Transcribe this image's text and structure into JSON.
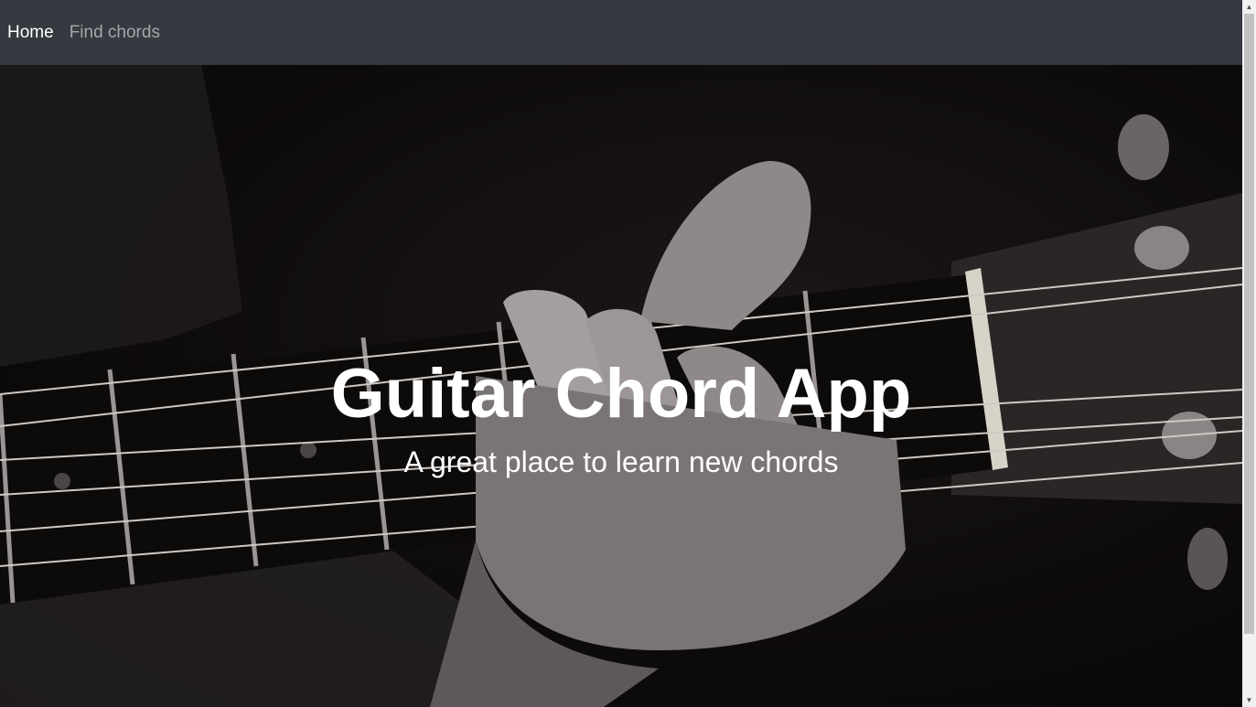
{
  "nav": {
    "home_label": "Home",
    "find_chords_label": "Find chords"
  },
  "hero": {
    "title": "Guitar Chord App",
    "subtitle": "A great place to learn new chords",
    "image_description_icon": "guitar-fretboard-hand-image"
  },
  "colors": {
    "navbar_bg": "#343a40",
    "nav_active": "#ffffff",
    "nav_inactive": "rgba(255,255,255,0.55)",
    "hero_text": "#ffffff"
  },
  "scrollbar": {
    "up_icon": "chevron-up-icon",
    "down_icon": "chevron-down-icon"
  }
}
